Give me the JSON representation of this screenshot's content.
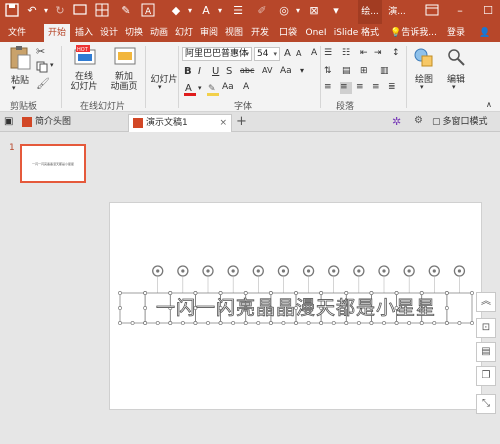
{
  "titlebar": {
    "doc_title_short": "绘...",
    "app_title_short": "演..."
  },
  "tabs": [
    {
      "label": "文件"
    },
    {
      "label": "开始"
    },
    {
      "label": "插入"
    },
    {
      "label": "设计"
    },
    {
      "label": "切换"
    },
    {
      "label": "动画"
    },
    {
      "label": "幻灯"
    },
    {
      "label": "审阅"
    },
    {
      "label": "视图"
    },
    {
      "label": "开发"
    },
    {
      "label": "口袋"
    },
    {
      "label": "OneI"
    },
    {
      "label": "iSlide"
    },
    {
      "label": "格式"
    },
    {
      "label": "告诉我..."
    },
    {
      "label": "登录"
    }
  ],
  "ribbon": {
    "paste_label": "粘贴",
    "new_slide_label": "在线\n幻灯片",
    "new_anim_label": "新加\n动画页",
    "slides_label": "幻灯片",
    "font_name": "阿里巴巴普惠体",
    "font_size": "54",
    "draw_label": "绘图",
    "edit_label": "编辑",
    "groups": {
      "clipboard": "剪贴板",
      "online": "在线幻灯片",
      "font": "字体",
      "paragraph": "段落"
    }
  },
  "doc_tabs": [
    {
      "label": "简介头图"
    },
    {
      "label": "演示文稿1"
    }
  ],
  "multi_window_label": "多窗口模式",
  "thumbnail": {
    "number": "1",
    "text": "一闪一闪亮晶晶漫天都是小星星"
  },
  "slide": {
    "text": "一闪一闪亮晶晶漫天都是小星星"
  },
  "colors": {
    "brand": "#b7472a",
    "accent_orange": "#e5593b"
  }
}
